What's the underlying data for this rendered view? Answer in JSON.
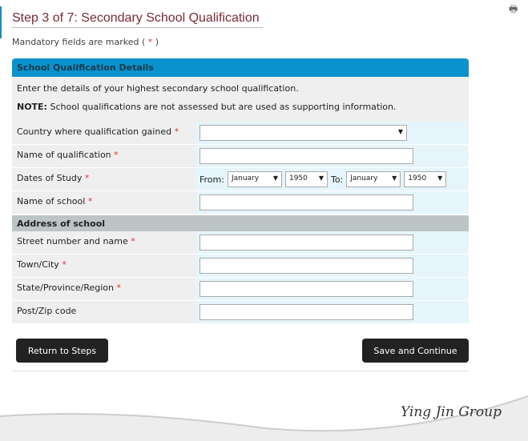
{
  "header": {
    "title": "Step 3 of 7: Secondary School Qualification",
    "mandatory_prefix": "Mandatory fields are marked ( ",
    "mandatory_star": "*",
    "mandatory_suffix": " )"
  },
  "panel": {
    "title": "School Qualification Details",
    "intro": "Enter the details of your highest secondary school qualification.",
    "note_label": "NOTE:",
    "note_text": " School qualifications are not assessed but are used as supporting information."
  },
  "fields": {
    "country": "Country where qualification gained",
    "qualification": "Name of qualification",
    "dates": "Dates of Study",
    "school": "Name of school",
    "street": "Street number and name",
    "town": "Town/City",
    "state": "State/Province/Region",
    "post": "Post/Zip code",
    "star": "*"
  },
  "dates": {
    "from_label": "From:",
    "to_label": "To:",
    "from_month": "January",
    "from_year": "1950",
    "to_month": "January",
    "to_year": "1950"
  },
  "address_header": "Address of school",
  "buttons": {
    "return": "Return to Steps",
    "save": "Save and Continue"
  },
  "brand": "Ying Jin Group"
}
